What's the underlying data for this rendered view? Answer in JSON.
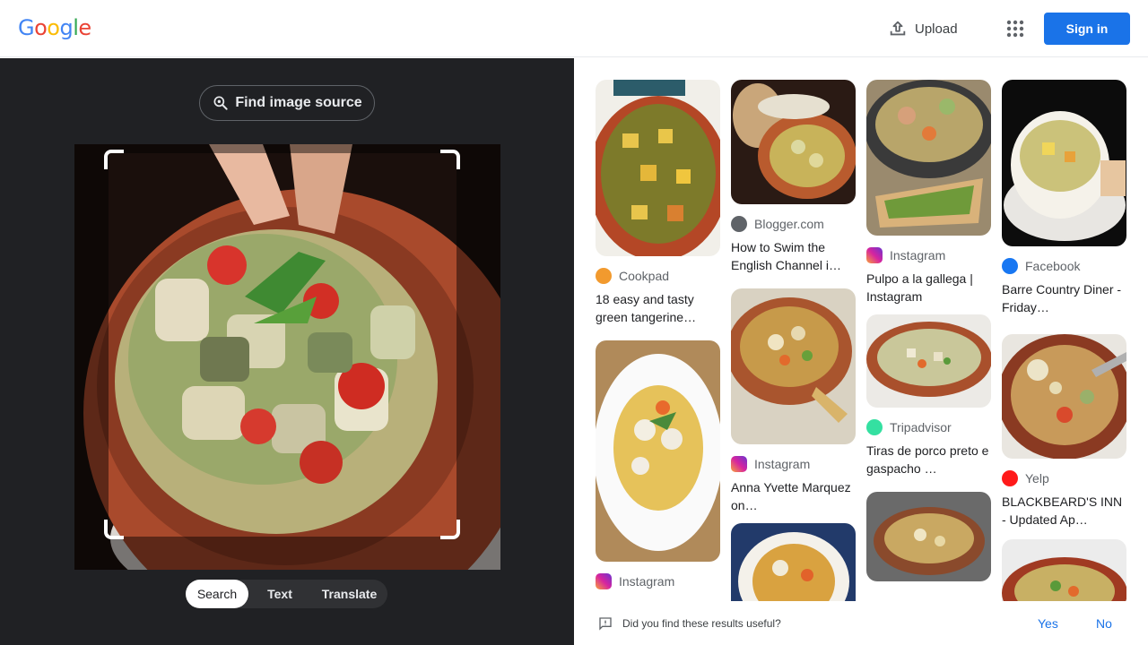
{
  "header": {
    "logo_letters": [
      "G",
      "o",
      "o",
      "g",
      "l",
      "e"
    ],
    "logo_colors": [
      "#4285F4",
      "#EA4335",
      "#FBBC05",
      "#4285F4",
      "#34A853",
      "#EA4335"
    ],
    "upload_label": "Upload",
    "signin_label": "Sign in"
  },
  "lens": {
    "find_source_label": "Find image source",
    "modes": [
      "Search",
      "Text",
      "Translate"
    ],
    "active_mode": "Search"
  },
  "results": [
    {
      "source": "Cookpad",
      "source_icon": "cookpad-icon",
      "title": "18 easy and tasty green tangerine…"
    },
    {
      "source": "Instagram",
      "source_icon": "instagram-icon",
      "title": ""
    },
    {
      "source": "Blogger.com",
      "source_icon": "globe-icon",
      "title": "How to Swim the English Channel i…"
    },
    {
      "source": "Instagram",
      "source_icon": "instagram-icon",
      "title": "Anna Yvette Marquez on…"
    },
    {
      "source": "Instagram",
      "source_icon": "instagram-icon",
      "title": "Pulpo a la gallega | Instagram"
    },
    {
      "source": "Tripadvisor",
      "source_icon": "tripadvisor-icon",
      "title": "Tiras de porco preto e gaspacho …"
    },
    {
      "source": "Facebook",
      "source_icon": "facebook-icon",
      "title": "Barre Country Diner - Friday…"
    },
    {
      "source": "Yelp",
      "source_icon": "yelp-icon",
      "title": "BLACKBEARD'S INN - Updated Ap…"
    }
  ],
  "feedback": {
    "question": "Did you find these results useful?",
    "yes": "Yes",
    "no": "No"
  },
  "colors": {
    "accent": "#1a73e8",
    "panel_dark": "#202124",
    "instagram": "#d6249f",
    "facebook": "#1877f2",
    "yelp": "#ff1a1a",
    "tripadvisor": "#34e0a1",
    "cookpad": "#f29a2e"
  }
}
